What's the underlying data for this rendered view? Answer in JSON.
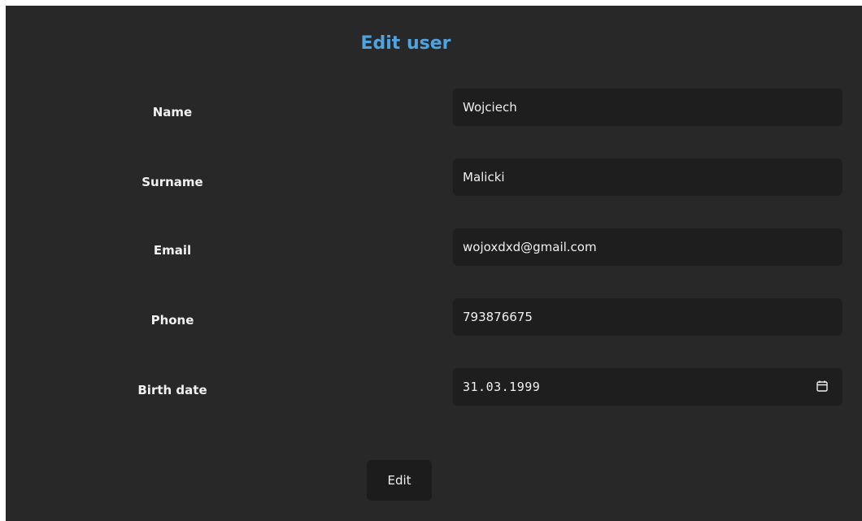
{
  "title": "Edit user",
  "fields": [
    {
      "label": "Name",
      "value": "Wojciech"
    },
    {
      "label": "Surname",
      "value": "Malicki"
    },
    {
      "label": "Email",
      "value": "wojoxdxd@gmail.com"
    },
    {
      "label": "Phone",
      "value": "793876675"
    },
    {
      "label": "Birth date",
      "value": "31.03.1999",
      "icon": "calendar-icon"
    }
  ],
  "submit_label": "Edit",
  "colors": {
    "background": "#282828",
    "input_background": "#1e1e1e",
    "title": "#4fa3e0",
    "text": "#f0f0f0"
  }
}
